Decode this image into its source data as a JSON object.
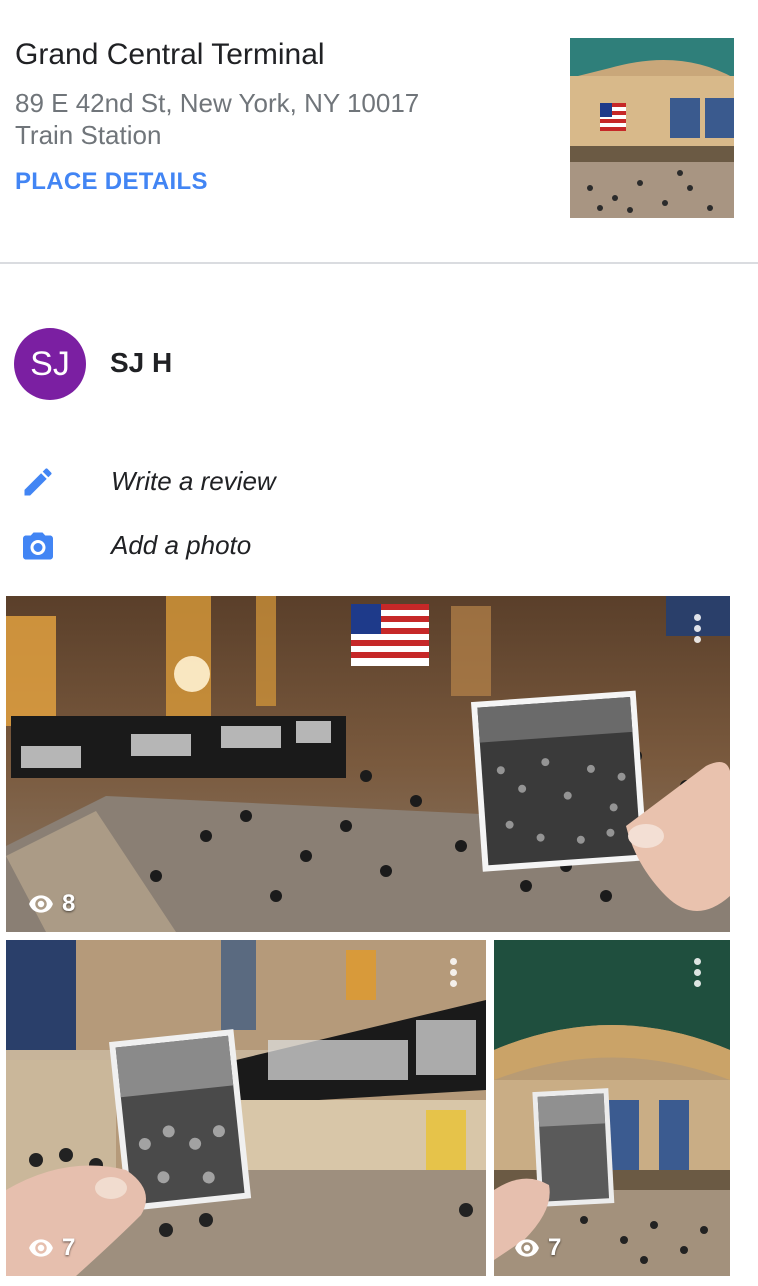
{
  "place": {
    "name": "Grand Central Terminal",
    "address": "89 E 42nd St, New York, NY 10017",
    "category": "Train Station",
    "details_link": "PLACE DETAILS",
    "thumbnail_icon": "grand-central-interior-photo"
  },
  "user": {
    "initials": "SJ",
    "name": "SJ H",
    "avatar_color": "#7b1fa2"
  },
  "actions": {
    "write_review": {
      "label": "Write a review",
      "icon": "pencil-icon"
    },
    "add_photo": {
      "label": "Add a photo",
      "icon": "camera-icon"
    }
  },
  "photos": [
    {
      "views": "8"
    },
    {
      "views": "7"
    },
    {
      "views": "7"
    }
  ],
  "colors": {
    "accent": "#4285f4",
    "avatar": "#7b1fa2"
  }
}
